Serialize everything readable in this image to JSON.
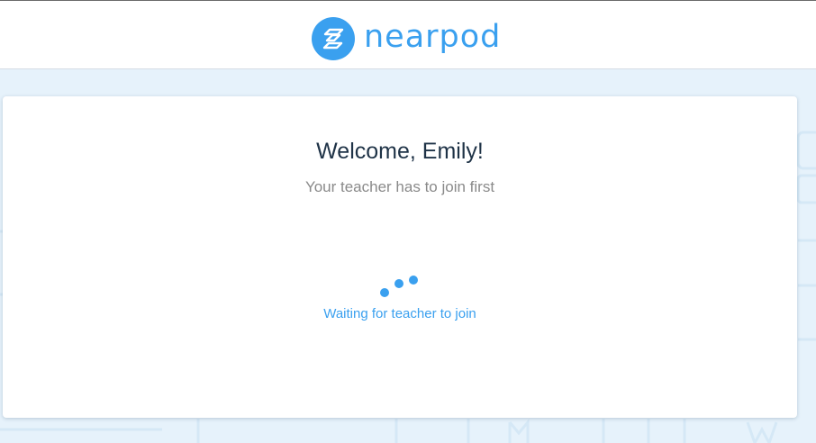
{
  "header": {
    "logo_text": "nearpod",
    "logo_icon": "nearpod-logo-icon",
    "brand_color": "#3aa0ef"
  },
  "card": {
    "welcome": "Welcome, Emily!",
    "subtitle": "Your teacher has to join first",
    "status": "Waiting for teacher to join",
    "spinner_icon": "loading-dots-icon"
  },
  "colors": {
    "background": "#e6f2fb",
    "title_text": "#1f3347",
    "subtitle_text": "#8a8a8a",
    "accent": "#3aa0ef"
  }
}
